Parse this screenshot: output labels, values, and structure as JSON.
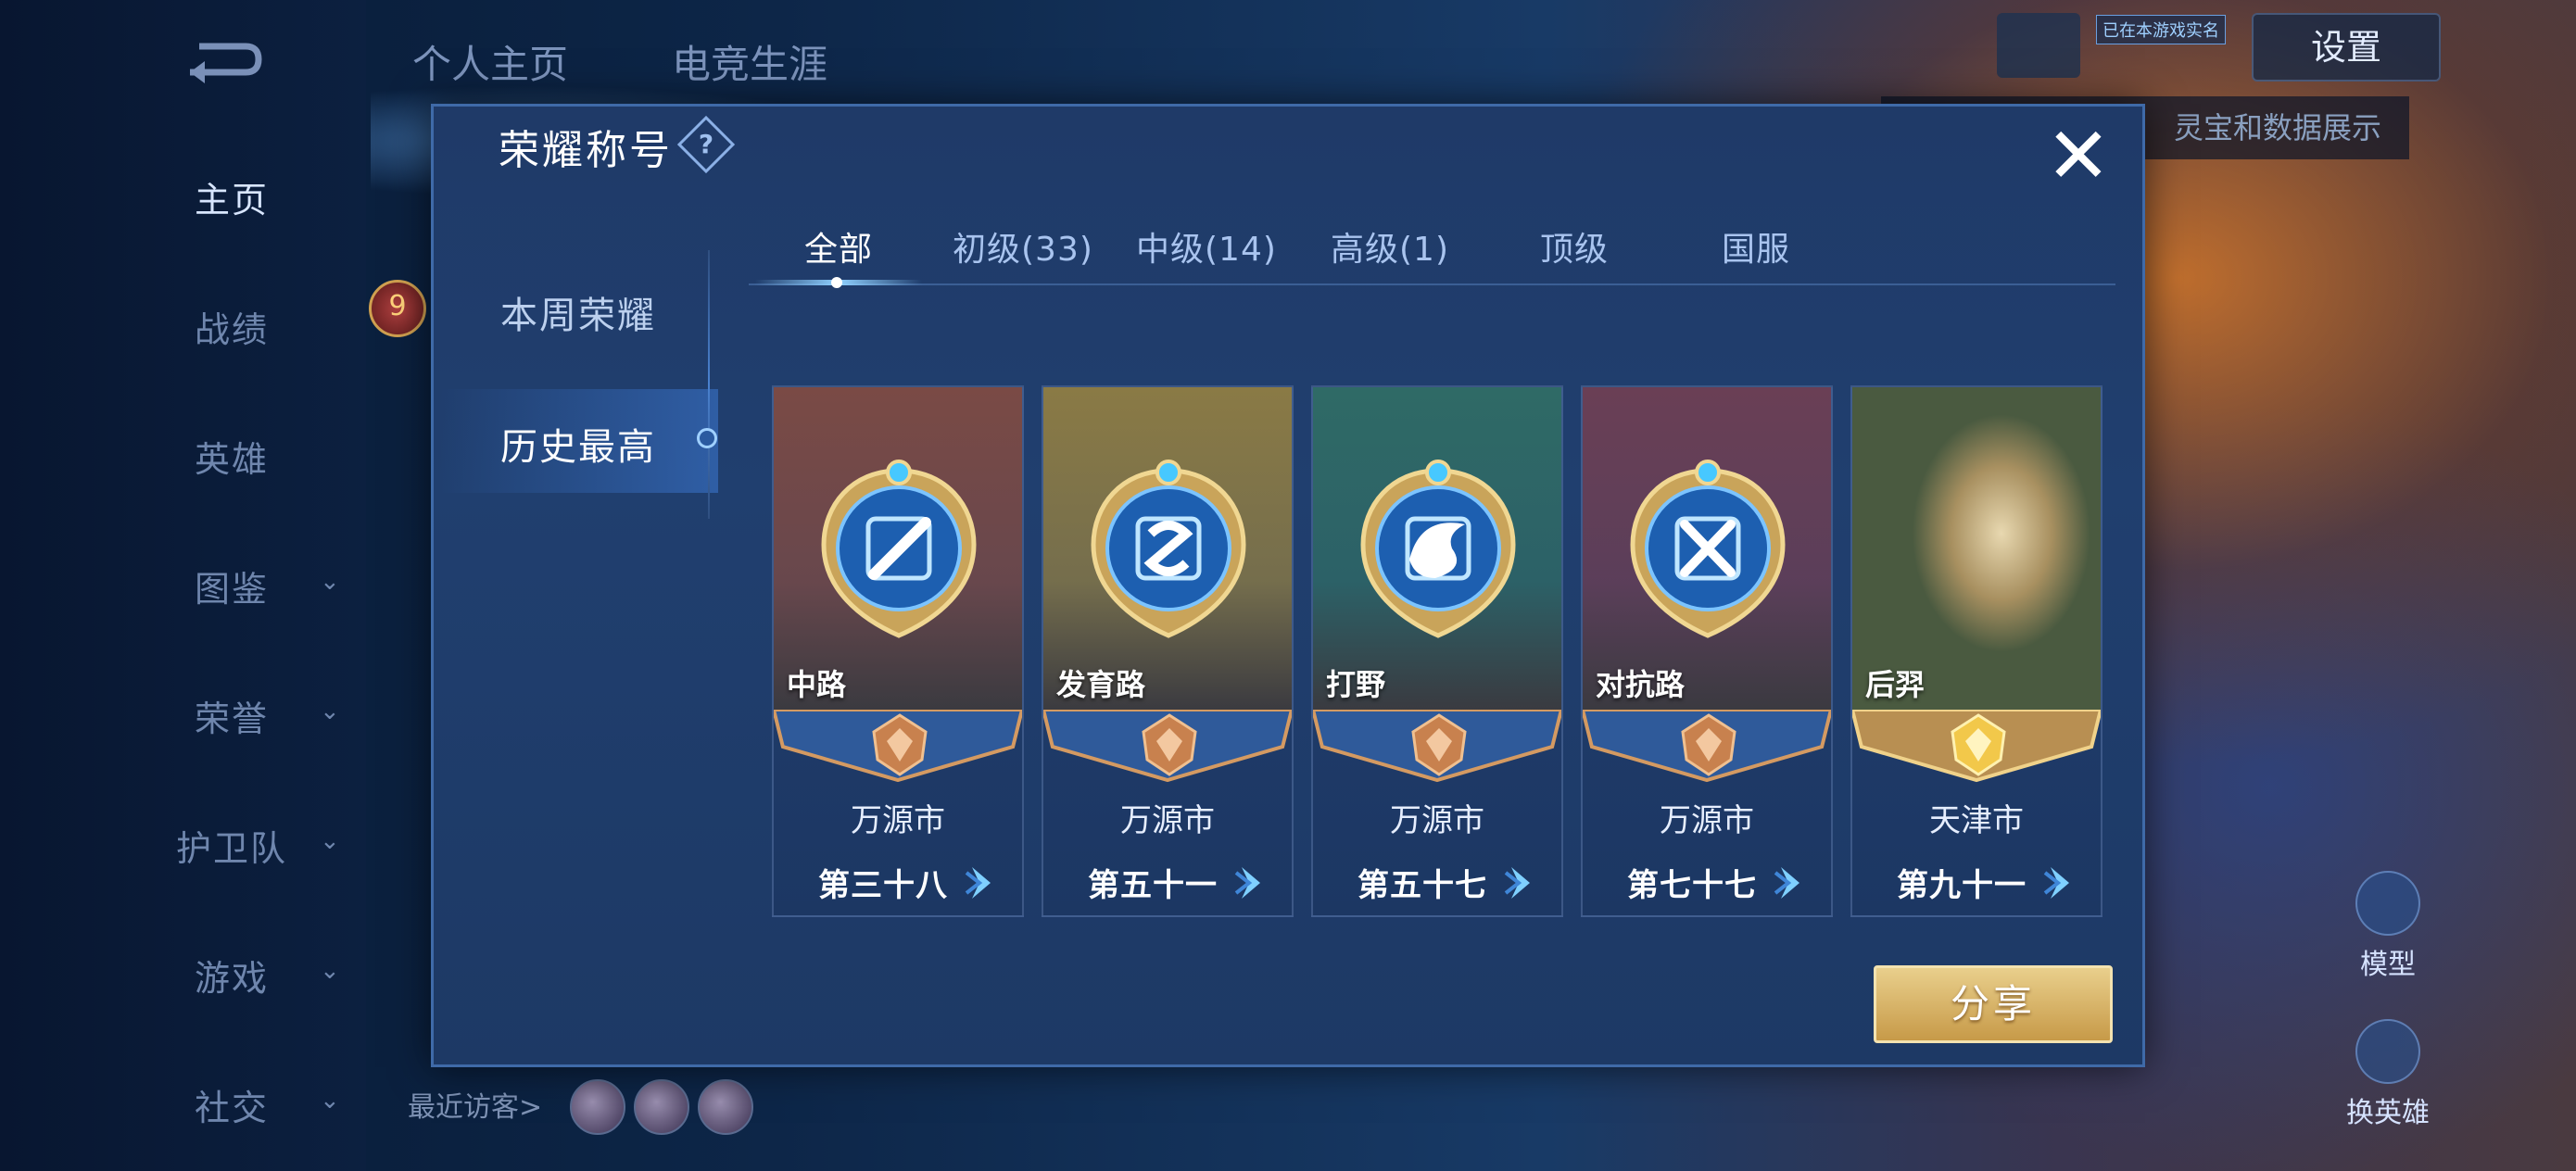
{
  "background": {
    "top_tabs": [
      "个人主页",
      "电竞生涯"
    ],
    "nav": [
      {
        "label": "主页",
        "active": true,
        "chevron": false
      },
      {
        "label": "战绩",
        "active": false,
        "chevron": false
      },
      {
        "label": "英雄",
        "active": false,
        "chevron": false
      },
      {
        "label": "图鉴",
        "active": false,
        "chevron": true
      },
      {
        "label": "荣誉",
        "active": false,
        "chevron": true
      },
      {
        "label": "护卫队",
        "active": false,
        "chevron": true
      },
      {
        "label": "游戏",
        "active": false,
        "chevron": true
      },
      {
        "label": "社交",
        "active": false,
        "chevron": true
      }
    ],
    "settings_label": "设置",
    "realname_tag": "已在本游戏实名",
    "hint_text": "灵宝和数据展示",
    "level": "9",
    "visitors_label": "最近访客>",
    "side_buttons": [
      "模型",
      "换英雄"
    ]
  },
  "dialog": {
    "title": "荣耀称号",
    "help_glyph": "?",
    "close_glyph": "✕",
    "menu": [
      {
        "label": "本周荣耀",
        "active": false
      },
      {
        "label": "历史最高",
        "active": true
      }
    ],
    "tabs": [
      {
        "label": "全部",
        "active": true
      },
      {
        "label": "初级(33)",
        "active": false
      },
      {
        "label": "中级(14)",
        "active": false
      },
      {
        "label": "高级(1)",
        "active": false
      },
      {
        "label": "顶级",
        "active": false
      },
      {
        "label": "国服",
        "active": false
      }
    ],
    "cards": [
      {
        "name": "中路",
        "city": "万源市",
        "place": "第三十八",
        "theme": "#7a4a45",
        "icon": "sword-icon",
        "tier": "bronze"
      },
      {
        "name": "发育路",
        "city": "万源市",
        "place": "第五十一",
        "theme": "#8a7a45",
        "icon": "swirl-icon",
        "tier": "bronze"
      },
      {
        "name": "打野",
        "city": "万源市",
        "place": "第五十七",
        "theme": "#2f6a66",
        "icon": "dragon-icon",
        "tier": "bronze"
      },
      {
        "name": "对抗路",
        "city": "万源市",
        "place": "第七十七",
        "theme": "#6a3f55",
        "icon": "crossed-swords-icon",
        "tier": "bronze"
      },
      {
        "name": "后羿",
        "city": "天津市",
        "place": "第九十一",
        "theme": "#6a6a50",
        "icon": "hero-portrait",
        "tier": "gold"
      }
    ],
    "share_label": "分享"
  },
  "colors": {
    "accent_blue": "#8fd0ff",
    "gold": "#d9b26a",
    "bronze": "#c8814e",
    "dialog_bg": "#1f3a68"
  }
}
